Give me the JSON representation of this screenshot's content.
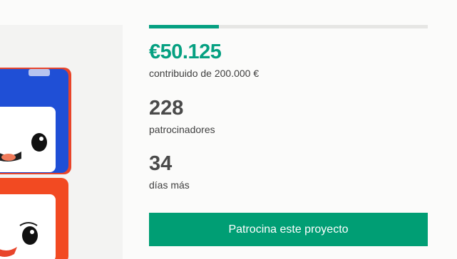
{
  "funding": {
    "progress_fraction": 0.25,
    "pledged": "€50.125",
    "pledged_label": "contribuido de 200.000 €",
    "backers_count": "228",
    "backers_label": "patrocinadores",
    "days_count": "34",
    "days_label": "días más"
  },
  "cta": {
    "label": "Patrocina este proyecto"
  },
  "colors": {
    "accent": "#05a081",
    "button": "#009e74",
    "track": "#e6e6e4"
  }
}
